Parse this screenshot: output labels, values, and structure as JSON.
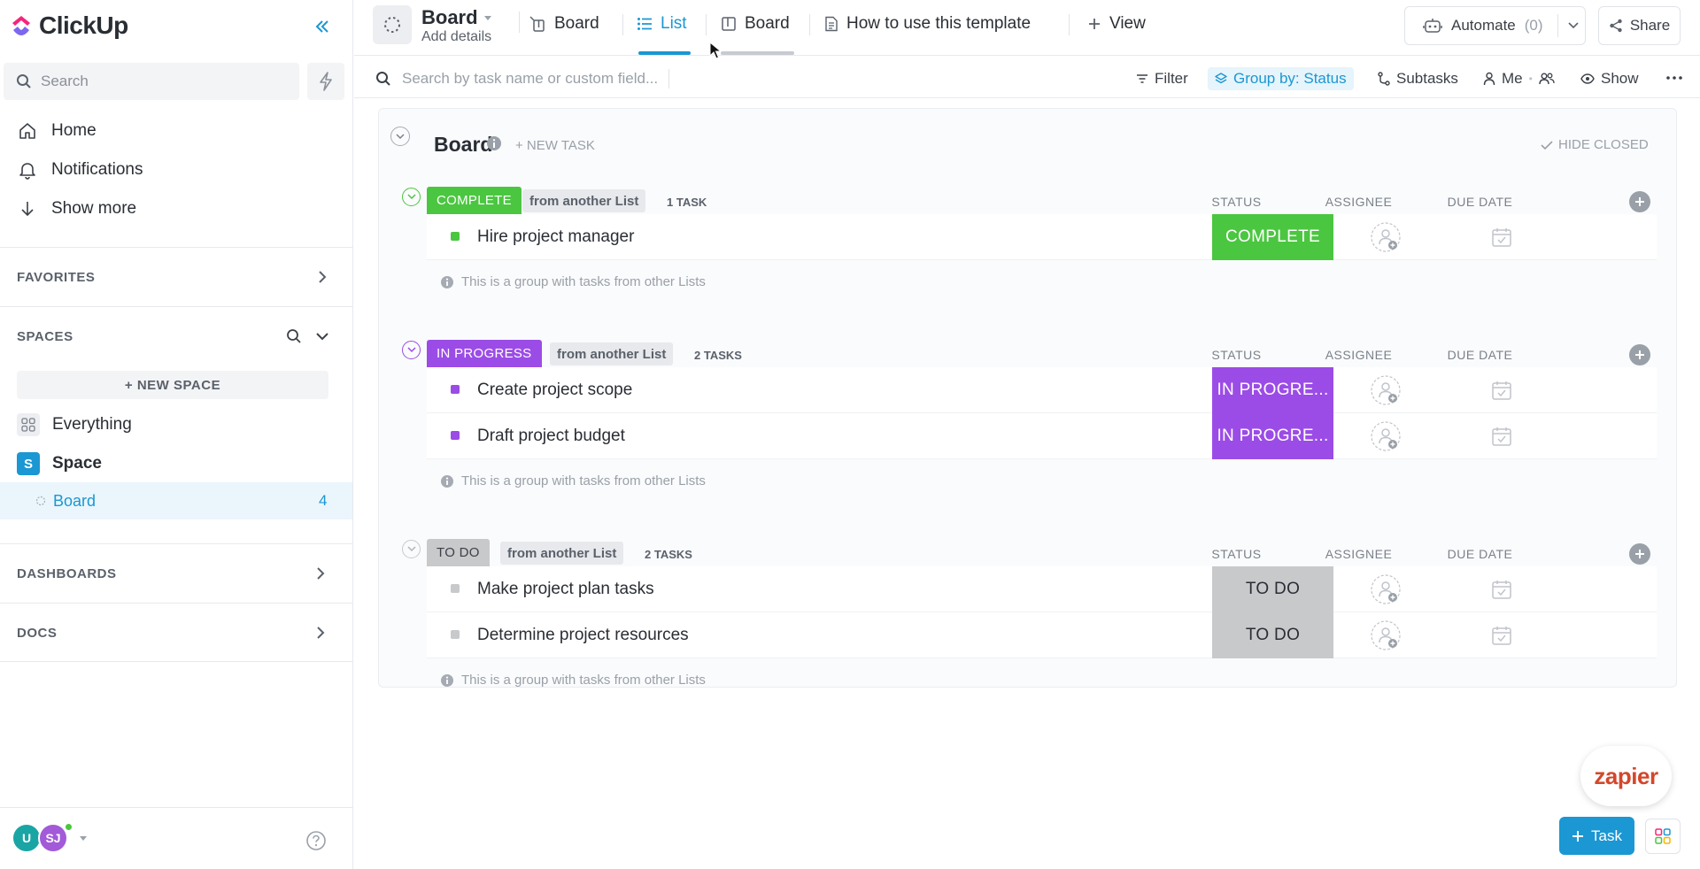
{
  "app": {
    "name": "ClickUp"
  },
  "sidebar": {
    "search_placeholder": "Search",
    "nav": [
      {
        "label": "Home",
        "icon": "home-icon"
      },
      {
        "label": "Notifications",
        "icon": "bell-icon"
      },
      {
        "label": "Show more",
        "icon": "arrow-down-icon"
      }
    ],
    "favorites_label": "FAVORITES",
    "spaces_label": "SPACES",
    "new_space_label": "+ NEW SPACE",
    "spaces": [
      {
        "label": "Everything",
        "icon": "grid-icon"
      },
      {
        "label": "Space",
        "initial": "S",
        "color": "#1b97d3"
      }
    ],
    "board_item": {
      "label": "Board",
      "count": "4"
    },
    "dashboards_label": "DASHBOARDS",
    "docs_label": "DOCS",
    "user": {
      "avatar1": "U",
      "avatar2": "SJ"
    }
  },
  "topbar": {
    "title": "Board",
    "subtitle": "Add details",
    "tabs": [
      {
        "label": "Board"
      },
      {
        "label": "List"
      },
      {
        "label": "Board"
      },
      {
        "label": "How to use this template"
      },
      {
        "label": "View"
      }
    ],
    "automate_label": "Automate",
    "automate_count": "(0)",
    "share_label": "Share"
  },
  "toolbar": {
    "search_placeholder": "Search by task name or custom field...",
    "filter": "Filter",
    "group_by": "Group by: Status",
    "subtasks": "Subtasks",
    "me": "Me",
    "show": "Show"
  },
  "board": {
    "title": "Board",
    "new_task": "+ NEW TASK",
    "hide_closed": "HIDE CLOSED",
    "columns": {
      "status": "STATUS",
      "assignee": "ASSIGNEE",
      "due": "DUE DATE"
    },
    "note": "This is a group with tasks from other Lists",
    "groups": [
      {
        "status": "COMPLETE",
        "color": "#4bc640",
        "from": "from another List",
        "count": "1 TASK",
        "tasks": [
          {
            "name": "Hire project manager",
            "status": "COMPLETE"
          }
        ]
      },
      {
        "status": "IN PROGRESS",
        "color": "#9b4ce6",
        "from": "from another List",
        "count": "2 TASKS",
        "tasks": [
          {
            "name": "Create project scope",
            "status": "IN PROGRE..."
          },
          {
            "name": "Draft project budget",
            "status": "IN PROGRE..."
          }
        ]
      },
      {
        "status": "TO DO",
        "color": "#c8c9cb",
        "from": "from another List",
        "count": "2 TASKS",
        "tasks": [
          {
            "name": "Make project plan tasks",
            "status": "TO DO"
          },
          {
            "name": "Determine project resources",
            "status": "TO DO"
          }
        ]
      }
    ]
  },
  "floating": {
    "zapier": "zapier",
    "task_button": "Task"
  }
}
